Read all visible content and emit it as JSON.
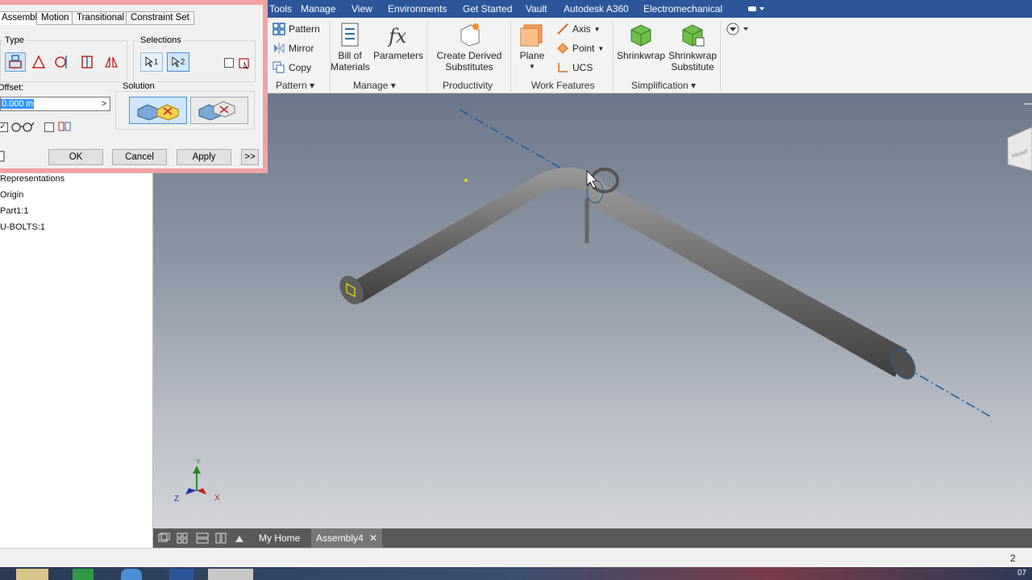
{
  "ribbon_tabs": [
    "Tools",
    "Manage",
    "View",
    "Environments",
    "Get Started",
    "Vault",
    "Autodesk A360",
    "Electromechanical"
  ],
  "ribbon": {
    "pattern_group": {
      "pattern": "Pattern",
      "mirror": "Mirror",
      "copy": "Copy",
      "label": "Pattern"
    },
    "manage_group": {
      "bom_line1": "Bill of",
      "bom_line2": "Materials",
      "parameters": "Parameters",
      "label": "Manage"
    },
    "productivity_group": {
      "line1": "Create Derived",
      "line2": "Substitutes",
      "label": "Productivity"
    },
    "work_features_group": {
      "plane": "Plane",
      "axis": "Axis",
      "point": "Point",
      "ucs": "UCS",
      "label": "Work Features"
    },
    "simplification_group": {
      "shrinkwrap": "Shrinkwrap",
      "sub_line1": "Shrinkwrap",
      "sub_line2": "Substitute",
      "label": "Simplification"
    }
  },
  "dialog": {
    "tabs": [
      "Assembly",
      "Motion",
      "Transitional",
      "Constraint Set"
    ],
    "type_label": "Type",
    "selections_label": "Selections",
    "sel1": "1",
    "sel2": "2",
    "offset_label": "Offset:",
    "offset_value": "0.000 in",
    "solution_label": "Solution",
    "ok": "OK",
    "cancel": "Cancel",
    "apply": "Apply",
    "more": ">>"
  },
  "browser": {
    "items": [
      "Representations",
      "Origin",
      "Part1:1",
      "U-BOLTS:1"
    ]
  },
  "viewcube": {
    "label": "FRONT"
  },
  "triad": {
    "x": "X",
    "y": "Y",
    "z": "Z"
  },
  "doc_tabs": {
    "home": "My Home",
    "doc": "Assembly4",
    "close": "✕"
  },
  "status": {
    "count": "2",
    "clock": "07"
  }
}
